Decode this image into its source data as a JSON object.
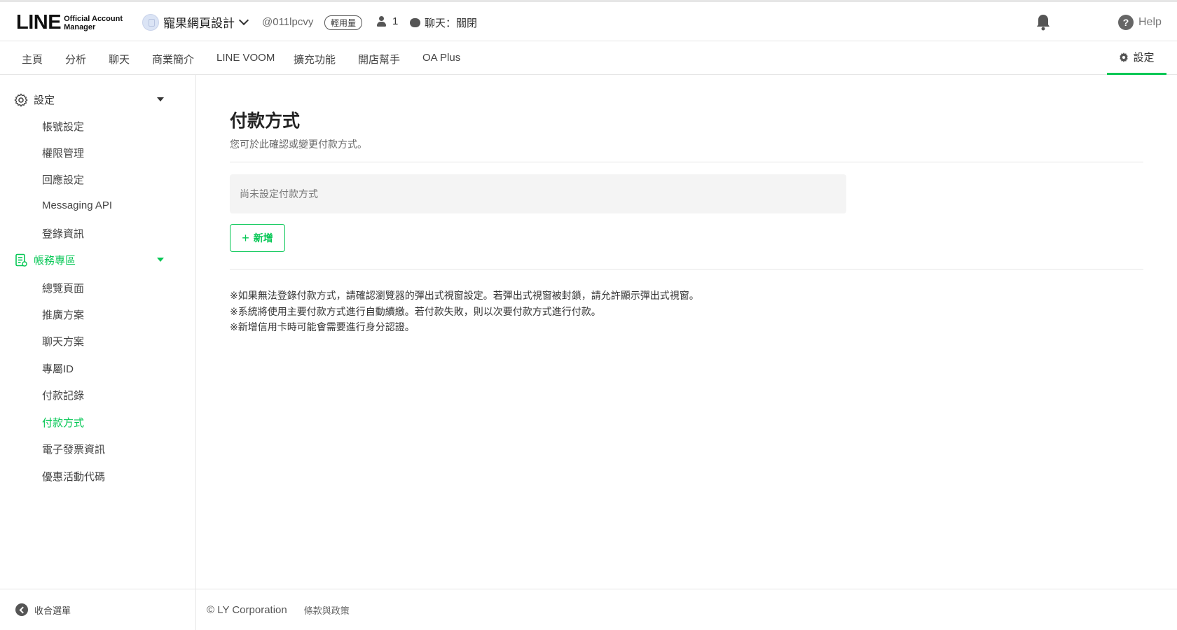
{
  "header": {
    "logo_main": "LINE",
    "logo_sub1": "Official Account",
    "logo_sub2": "Manager",
    "account_name": "寵果網頁設計",
    "account_id": "@011lpcvy",
    "plan_badge": "輕用量",
    "friends_count": "1",
    "chat_status": "聊天：關閉",
    "help_label": "Help"
  },
  "nav": {
    "tabs": [
      "主頁",
      "分析",
      "聊天",
      "商業簡介",
      "LINE VOOM",
      "擴充功能",
      "開店幫手",
      "OA Plus"
    ],
    "settings_label": "設定"
  },
  "sidebar": {
    "settings_section": "設定",
    "settings_items": [
      "帳號設定",
      "權限管理",
      "回應設定",
      "Messaging API",
      "登錄資訊"
    ],
    "billing_section": "帳務專區",
    "billing_items": [
      "總覽頁面",
      "推廣方案",
      "聊天方案",
      "專屬ID",
      "付款記錄",
      "付款方式",
      "電子發票資訊",
      "優惠活動代碼"
    ],
    "active_item": "付款方式",
    "collapse_label": "收合選單"
  },
  "main": {
    "title": "付款方式",
    "description": "您可於此確認或變更付款方式。",
    "empty_state": "尚未設定付款方式",
    "add_button": "新增",
    "notes": [
      "※如果無法登錄付款方式，請確認瀏覽器的彈出式視窗設定。若彈出式視窗被封鎖，請允許顯示彈出式視窗。",
      "※系統將使用主要付款方式進行自動續繳。若付款失敗，則以次要付款方式進行付款。",
      "※新增信用卡時可能會需要進行身分認證。"
    ]
  },
  "footer": {
    "copyright": "© LY Corporation",
    "terms": "條款與政策"
  },
  "colors": {
    "accent": "#06c755",
    "border": "#e6e6e6",
    "empty_bg": "#f4f4f4"
  }
}
